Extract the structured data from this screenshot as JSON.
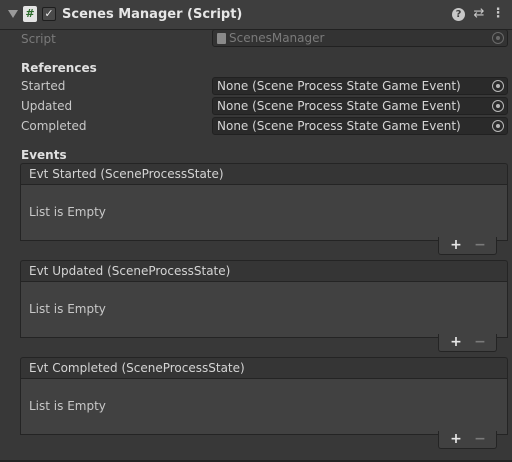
{
  "header": {
    "title": "Scenes Manager (Script)",
    "script_icon_glyph": "#",
    "enabled_checked": true,
    "help_icon": "help-icon",
    "presets_icon": "sliders-icon",
    "menu_icon": "kebab-menu-icon"
  },
  "script_row": {
    "label": "Script",
    "value": "ScenesManager"
  },
  "references": {
    "heading": "References",
    "fields": [
      {
        "label": "Started",
        "value": "None (Scene Process State Game Event)"
      },
      {
        "label": "Updated",
        "value": "None (Scene Process State Game Event)"
      },
      {
        "label": "Completed",
        "value": "None (Scene Process State Game Event)"
      }
    ]
  },
  "events": {
    "heading": "Events",
    "lists": [
      {
        "title": "Evt Started (SceneProcessState)",
        "empty_text": "List is Empty",
        "add": "+",
        "remove": "−"
      },
      {
        "title": "Evt Updated (SceneProcessState)",
        "empty_text": "List is Empty",
        "add": "+",
        "remove": "−"
      },
      {
        "title": "Evt Completed (SceneProcessState)",
        "empty_text": "List is Empty",
        "add": "+",
        "remove": "−"
      }
    ]
  },
  "colors": {
    "background": "#383838",
    "header": "#3e3e3e",
    "field": "#2a2a2a",
    "text": "#c8c8c8"
  }
}
